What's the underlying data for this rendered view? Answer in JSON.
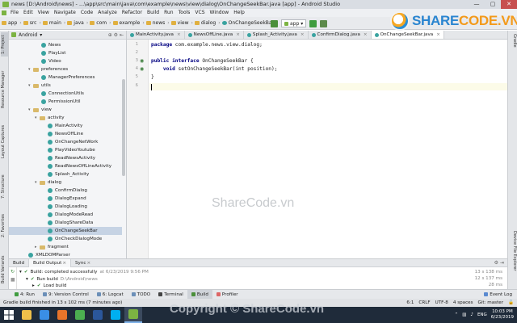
{
  "window": {
    "title": "news [D:\\Android\\news] - ...\\app\\src\\main\\java\\com\\example\\news\\view\\dialog\\OnChangeSeekBar.java [app] - Android Studio",
    "minimize": "—",
    "maximize": "▢",
    "close": "✕"
  },
  "brand": {
    "share": "SHARE",
    "code": "CODE.VN"
  },
  "menu": [
    "File",
    "Edit",
    "View",
    "Navigate",
    "Code",
    "Analyze",
    "Refactor",
    "Build",
    "Run",
    "Tools",
    "VCS",
    "Window",
    "Help"
  ],
  "breadcrumbs": [
    "app",
    "src",
    "main",
    "java",
    "com",
    "example",
    "news",
    "view",
    "dialog",
    "OnChangeSeekBar"
  ],
  "run_config": "app",
  "project_panel": {
    "view_mode": "Android",
    "rows": [
      {
        "label": "News",
        "kind": "class",
        "level": 5
      },
      {
        "label": "PlayList",
        "kind": "class",
        "level": 5
      },
      {
        "label": "Video",
        "kind": "class",
        "level": 5
      },
      {
        "label": "preferences",
        "kind": "folder",
        "level": 3,
        "arrow": "▾"
      },
      {
        "label": "ManagerPreferences",
        "kind": "class",
        "level": 5
      },
      {
        "label": "utils",
        "kind": "folder",
        "level": 3,
        "arrow": "▾"
      },
      {
        "label": "ConnectionUtils",
        "kind": "class",
        "level": 5
      },
      {
        "label": "PermissionUtil",
        "kind": "class",
        "level": 5
      },
      {
        "label": "view",
        "kind": "folder",
        "level": 3,
        "arrow": "▾"
      },
      {
        "label": "activity",
        "kind": "folder",
        "level": 4,
        "arrow": "▾"
      },
      {
        "label": "MainActivity",
        "kind": "class",
        "level": 6
      },
      {
        "label": "NewsOffLine",
        "kind": "class",
        "level": 6
      },
      {
        "label": "OnChangeNetWork",
        "kind": "class",
        "level": 6
      },
      {
        "label": "PlayVideoYoutube",
        "kind": "class",
        "level": 6
      },
      {
        "label": "ReadNewsActivity",
        "kind": "class",
        "level": 6
      },
      {
        "label": "ReadNewsOffLineActivity",
        "kind": "class",
        "level": 6
      },
      {
        "label": "Splash_Activity",
        "kind": "class",
        "level": 6
      },
      {
        "label": "dialog",
        "kind": "folder",
        "level": 4,
        "arrow": "▾"
      },
      {
        "label": "ConfirmDialog",
        "kind": "class",
        "level": 6
      },
      {
        "label": "DialogExpand",
        "kind": "class",
        "level": 6
      },
      {
        "label": "DialogLoading",
        "kind": "class",
        "level": 6
      },
      {
        "label": "DialogModeRead",
        "kind": "class",
        "level": 6
      },
      {
        "label": "DialogShareData",
        "kind": "class",
        "level": 6
      },
      {
        "label": "OnChangeSeekBar",
        "kind": "class",
        "level": 6,
        "selected": true
      },
      {
        "label": "OnCheckDialogMode",
        "kind": "class",
        "level": 6
      },
      {
        "label": "fragment",
        "kind": "folder",
        "level": 4,
        "arrow": "▸"
      },
      {
        "label": "XMLDOMParser",
        "kind": "class",
        "level": 3
      }
    ]
  },
  "left_tool_tabs": [
    "1: Project",
    "Resource Manager",
    "Layout Captures",
    "7: Structure",
    "2: Favorites",
    "Build Variants"
  ],
  "right_tool_tabs": [
    "Gradle",
    "Device File Explorer"
  ],
  "editor_tabs": [
    {
      "label": "MainActivity.java",
      "active": false
    },
    {
      "label": "NewsOffLine.java",
      "active": false
    },
    {
      "label": "Splash_Activity.java",
      "active": false
    },
    {
      "label": "ConfirmDialog.java",
      "active": false
    },
    {
      "label": "OnChangeSeekBar.java",
      "active": true
    }
  ],
  "editor": {
    "line_numbers": [
      "1",
      "2",
      "3",
      "4",
      "5",
      "6"
    ],
    "lines": [
      {
        "kw": "package",
        "rest": " com.example.news.view.dialog;"
      },
      {
        "kw": "",
        "rest": ""
      },
      {
        "kw": "public interface",
        "rest": " OnChangeSeekBar {"
      },
      {
        "kw": "    void",
        "rest": " setOnChangeSeekBar(int position);"
      },
      {
        "kw": "",
        "rest": "}"
      },
      {
        "kw": "",
        "rest": ""
      }
    ]
  },
  "watermark": "ShareCode.vn",
  "build_panel": {
    "tabs": [
      "Build",
      "Build Output",
      "Sync"
    ],
    "rows": [
      {
        "text": "Build: completed successfully",
        "detail": "at 6/23/2019 9:56 PM",
        "time": "13 s 138 ms"
      },
      {
        "text": "Run build",
        "detail": "D:\\Android\\news",
        "time": "12 s 137 ms"
      },
      {
        "text": "Load build",
        "detail": "",
        "time": "28 ms"
      }
    ]
  },
  "tool_windows": [
    "4: Run",
    "9: Version Control",
    "6: Logcat",
    "TODO",
    "Terminal",
    "Build",
    "Profiler"
  ],
  "event_log": "Event Log",
  "status": {
    "message": "Gradle build finished in 13 s 102 ms (7 minutes ago)",
    "position": "6:1",
    "line_sep": "CRLF",
    "encoding": "UTF-8",
    "indent": "4 spaces",
    "git": "Git: master"
  },
  "copyright": "Copyright © ShareCode.vn",
  "taskbar": {
    "apps": [
      {
        "name": "file-explorer",
        "color": "#f0c04a",
        "running": false
      },
      {
        "name": "internet-explorer",
        "color": "#3a8ee6",
        "running": false
      },
      {
        "name": "firefox",
        "color": "#e8742a",
        "running": false
      },
      {
        "name": "chrome",
        "color": "#4caf50",
        "running": false
      },
      {
        "name": "word",
        "color": "#2b579a",
        "running": false
      },
      {
        "name": "skype",
        "color": "#00aff0",
        "running": false
      },
      {
        "name": "android-studio",
        "color": "#7cb342",
        "running": true
      }
    ],
    "lang": "ENG",
    "time": "10:03 PM",
    "date": "6/23/2019"
  }
}
